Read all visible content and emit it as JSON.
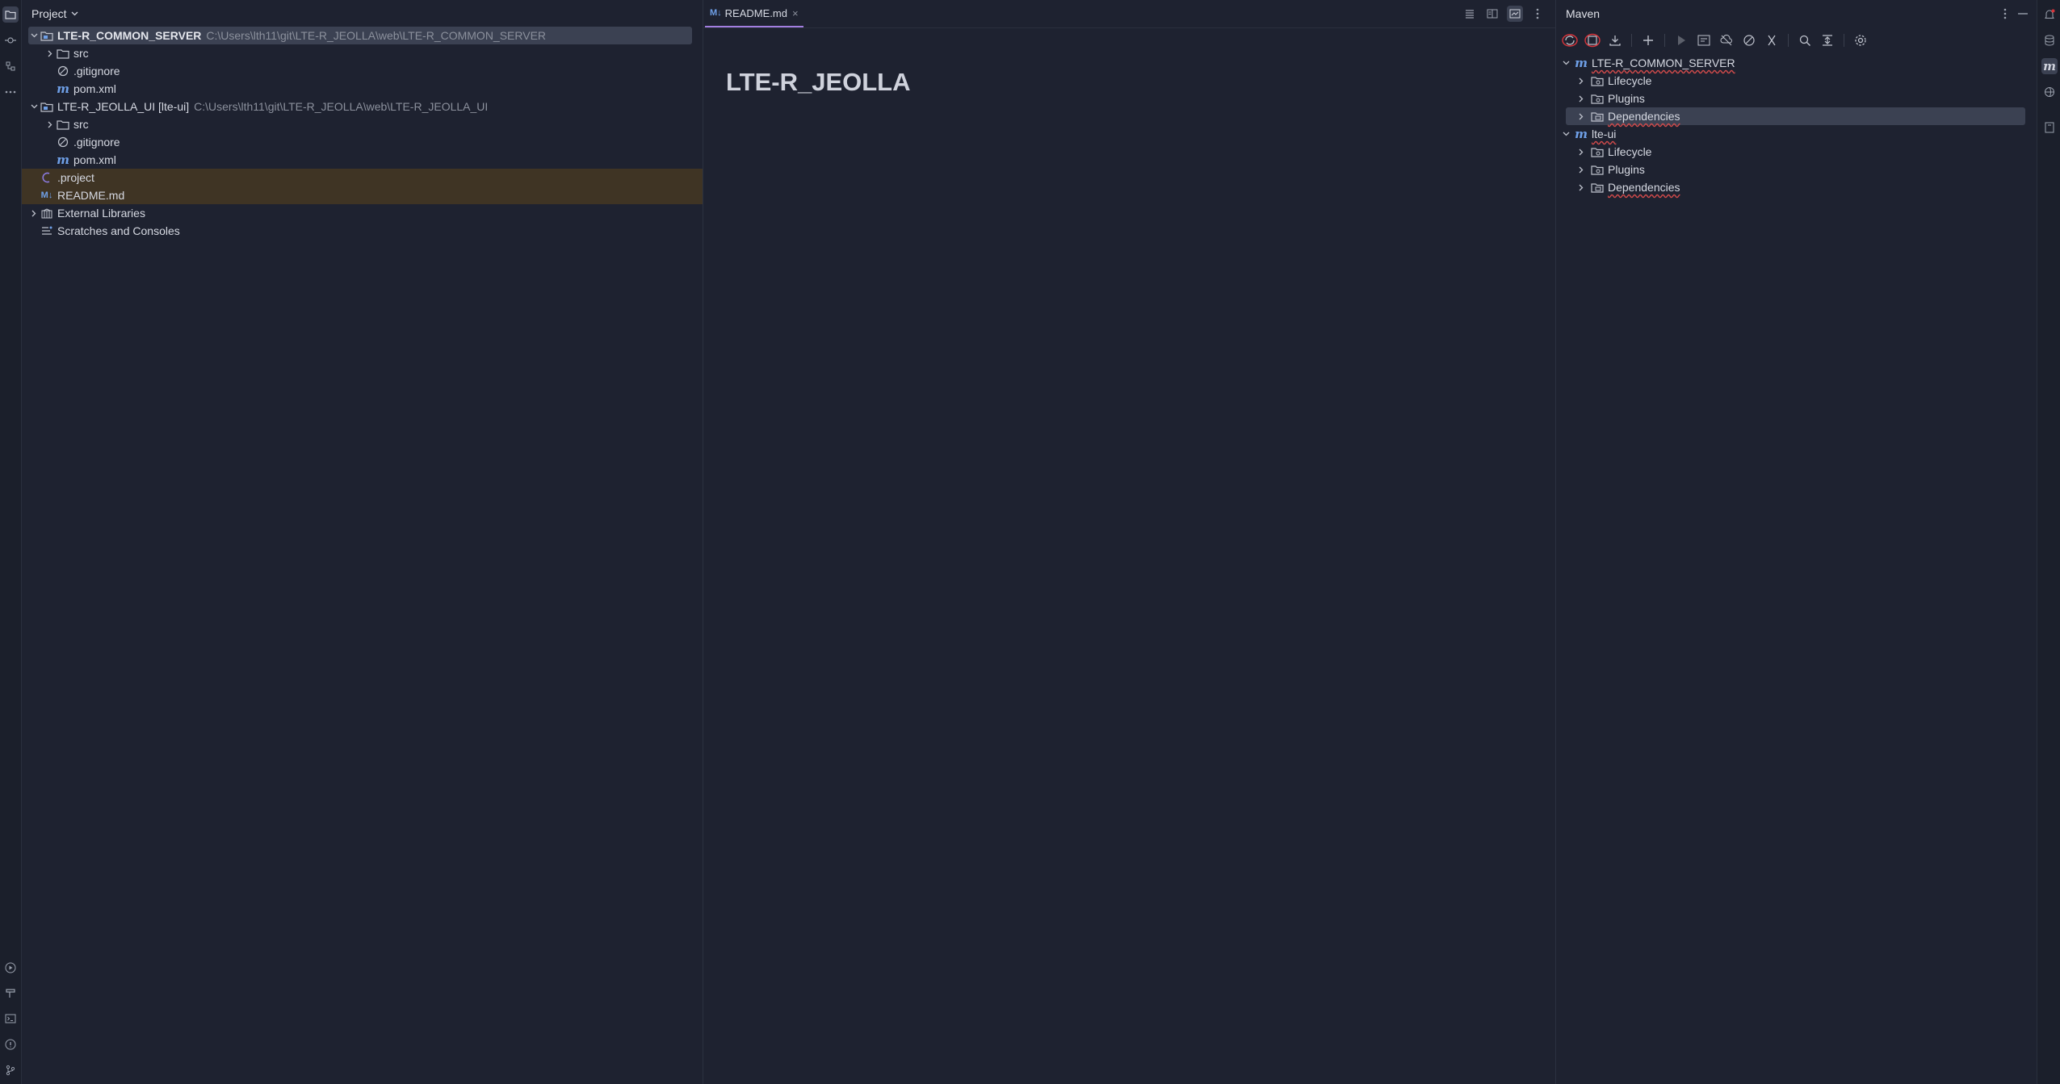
{
  "project_pane": {
    "title": "Project",
    "tree": [
      {
        "label": "LTE-R_COMMON_SERVER",
        "path": "C:\\Users\\lth11\\git\\LTE-R_JEOLLA\\web\\LTE-R_COMMON_SERVER"
      },
      {
        "label": "src"
      },
      {
        "label": ".gitignore"
      },
      {
        "label": "pom.xml"
      },
      {
        "label": "LTE-R_JEOLLA_UI [lte-ui]",
        "path": "C:\\Users\\lth11\\git\\LTE-R_JEOLLA\\web\\LTE-R_JEOLLA_UI"
      },
      {
        "label": "src"
      },
      {
        "label": ".gitignore"
      },
      {
        "label": "pom.xml"
      },
      {
        "label": ".project"
      },
      {
        "label": "README.md"
      },
      {
        "label": "External Libraries"
      },
      {
        "label": "Scratches and Consoles"
      }
    ]
  },
  "editor": {
    "tab_badge": "M↓",
    "tab_label": "README.md",
    "tab_close": "×",
    "heading": "LTE-R_JEOLLA"
  },
  "maven": {
    "title": "Maven",
    "tree": [
      {
        "label": "LTE-R_COMMON_SERVER"
      },
      {
        "label": "Lifecycle"
      },
      {
        "label": "Plugins"
      },
      {
        "label": "Dependencies"
      },
      {
        "label": "lte-ui"
      },
      {
        "label": "Lifecycle"
      },
      {
        "label": "Plugins"
      },
      {
        "label": "Dependencies"
      }
    ]
  },
  "colors": {
    "background": "#1e2230",
    "selection": "#3b4152",
    "modified_row": "#3f3424",
    "accent_tab": "#a27ee0",
    "maven_icon": "#6fa0e8",
    "error_underline": "#d24b4b"
  }
}
